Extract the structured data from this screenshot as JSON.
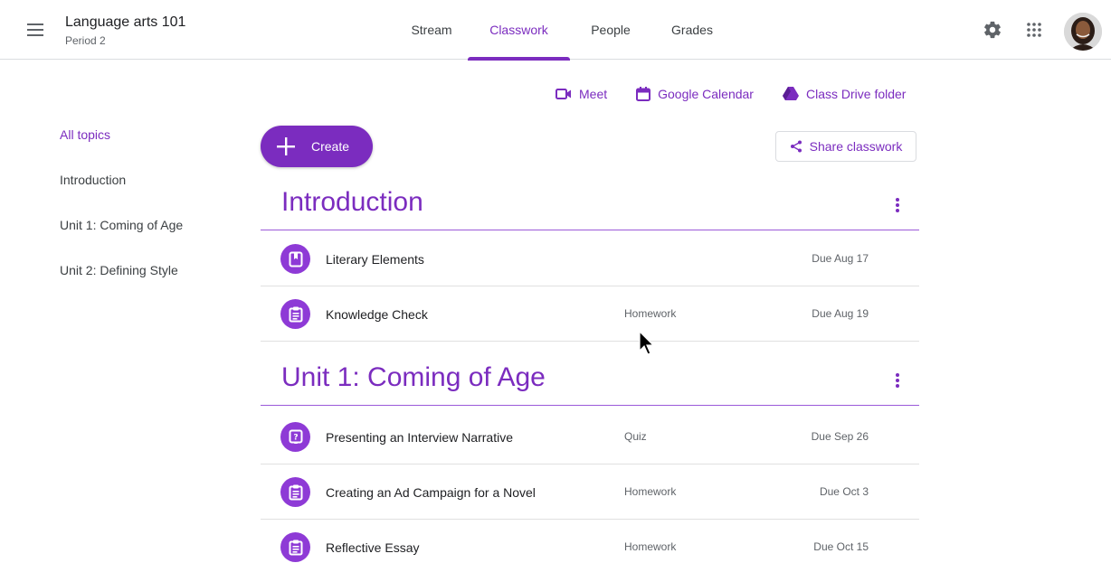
{
  "header": {
    "class_title": "Language arts 101",
    "class_subtitle": "Period 2",
    "tabs": [
      {
        "label": "Stream",
        "active": false
      },
      {
        "label": "Classwork",
        "active": true
      },
      {
        "label": "People",
        "active": false
      },
      {
        "label": "Grades",
        "active": false
      }
    ],
    "icons": [
      "menu-icon",
      "settings-icon",
      "apps-grid-icon",
      "user-avatar"
    ]
  },
  "quick_links": {
    "meet": "Meet",
    "calendar": "Google Calendar",
    "drive": "Class Drive folder"
  },
  "toolbar": {
    "create_label": "Create",
    "share_label": "Share classwork"
  },
  "topics": [
    {
      "label": "All topics",
      "active": true
    },
    {
      "label": "Introduction",
      "active": false
    },
    {
      "label": "Unit 1: Coming of Age",
      "active": false
    },
    {
      "label": "Unit 2: Defining Style",
      "active": false
    }
  ],
  "sections": [
    {
      "title": "Introduction",
      "items": [
        {
          "title": "Literary Elements",
          "type": "",
          "due": "Due Aug 17",
          "icon": "material-icon"
        },
        {
          "title": "Knowledge Check",
          "type": "Homework",
          "due": "Due Aug 19",
          "icon": "assignment-icon"
        }
      ]
    },
    {
      "title": "Unit 1: Coming of Age",
      "items": [
        {
          "title": "Presenting an Interview Narrative",
          "type": "Quiz",
          "due": "Due Sep 26",
          "icon": "question-icon"
        },
        {
          "title": "Creating an Ad Campaign for a Novel",
          "type": "Homework",
          "due": "Due Oct 3",
          "icon": "assignment-icon"
        },
        {
          "title": "Reflective Essay",
          "type": "Homework",
          "due": "Due Oct 15",
          "icon": "assignment-icon"
        }
      ]
    }
  ],
  "colors": {
    "accent": "#7b2cbf",
    "icon_bg": "#8e3ad6",
    "divider": "#e0e0e0"
  }
}
